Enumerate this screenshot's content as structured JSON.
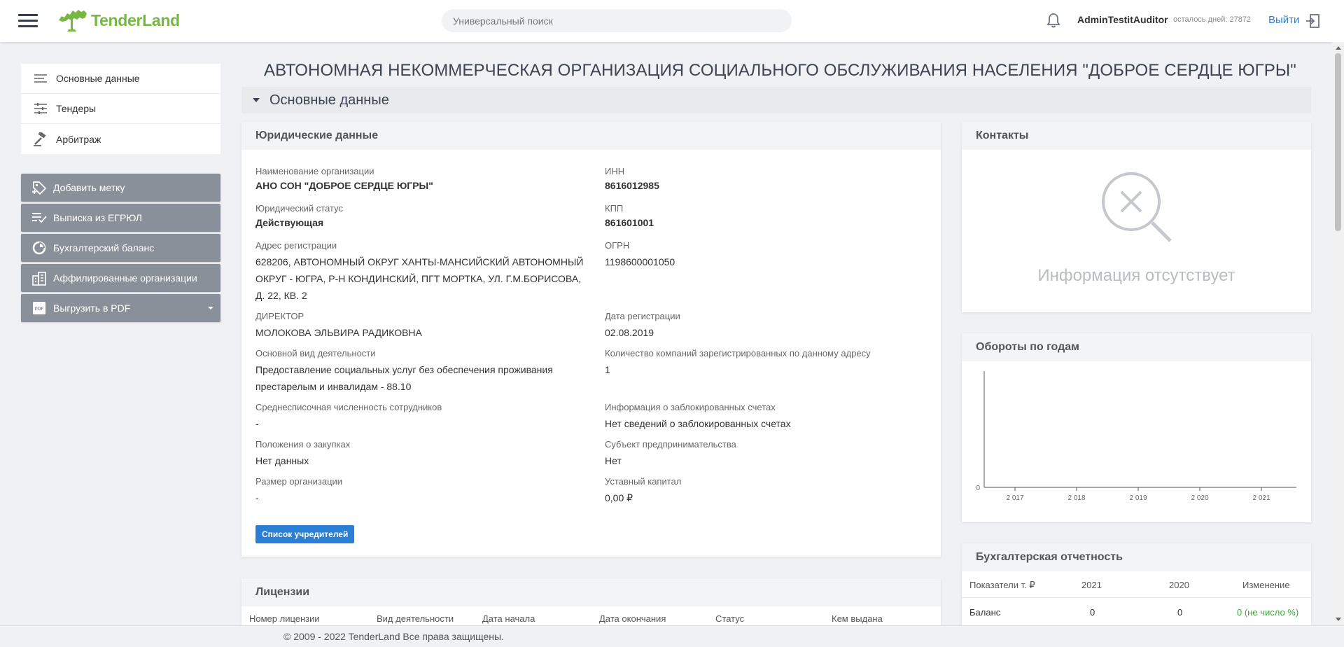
{
  "header": {
    "logo_text": "TenderLand",
    "search_placeholder": "Универсальный поиск",
    "username": "AdminTestitAuditor",
    "days_left": "осталось дней: 27872",
    "logout_label": "Выйти"
  },
  "sidebar": {
    "items": [
      {
        "label": "Основные данные",
        "icon": "lines-icon"
      },
      {
        "label": "Тендеры",
        "icon": "sliders-icon"
      },
      {
        "label": "Арбитраж",
        "icon": "gavel-icon"
      }
    ],
    "actions": [
      {
        "label": "Добавить метку",
        "icon": "tag-add-icon"
      },
      {
        "label": "Выписка из ЕГРЮЛ",
        "icon": "list-check-icon"
      },
      {
        "label": "Бухгалтерский баланс",
        "icon": "pie-chart-icon"
      },
      {
        "label": "Аффилированные организации",
        "icon": "buildings-icon"
      },
      {
        "label": "Выгрузить в PDF",
        "icon": "pdf-icon"
      }
    ]
  },
  "main": {
    "org_title": "АВТОНОМНАЯ НЕКОММЕРЧЕСКАЯ ОРГАНИЗАЦИЯ СОЦИАЛЬНОГО ОБСЛУЖИВАНИЯ НАСЕЛЕНИЯ \"ДОБРОЕ СЕРДЦЕ ЮГРЫ\"",
    "section_label": "Основные данные"
  },
  "legal": {
    "title": "Юридические данные",
    "fields": [
      {
        "label": "Наименование организации",
        "value": "АНО СОН \"ДОБРОЕ СЕРДЦЕ ЮГРЫ\""
      },
      {
        "label": "ИНН",
        "value": "8616012985"
      },
      {
        "label": "Юридический статус",
        "value": "Действующая"
      },
      {
        "label": "КПП",
        "value": "861601001"
      },
      {
        "label": "Адрес регистрации",
        "value": "628206, АВТОНОМНЫЙ ОКРУГ ХАНТЫ-МАНСИЙСКИЙ АВТОНОМНЫЙ ОКРУГ - ЮГРА, Р-Н КОНДИНСКИЙ, ПГТ МОРТКА, УЛ. Г.М.БОРИСОВА, Д. 22, КВ. 2"
      },
      {
        "label": "ОГРН",
        "value": "1198600001050"
      },
      {
        "label": "ДИРЕКТОР",
        "value": "МОЛОКОВА ЭЛЬВИРА РАДИКОВНА"
      },
      {
        "label": "Дата регистрации",
        "value": "02.08.2019"
      },
      {
        "label": "Основной вид деятельности",
        "value": "Предоставление социальных услуг без обеспечения проживания престарелым и инвалидам - 88.10"
      },
      {
        "label": "Количество компаний зарегистрированных по данному адресу",
        "value": "1"
      },
      {
        "label": "Среднесписочная численность сотрудников",
        "value": "-"
      },
      {
        "label": "Информация о заблокированных счетах",
        "value": "Нет сведений о заблокированных счетах"
      },
      {
        "label": "Положения о закупках",
        "value": "Нет данных"
      },
      {
        "label": "Субъект предпринимательства",
        "value": "Нет"
      },
      {
        "label": "Размер организации",
        "value": "-"
      },
      {
        "label": "Уставный капитал",
        "value": "0,00 ₽"
      }
    ],
    "founders_button": "Список учредителей"
  },
  "contacts": {
    "title": "Контакты",
    "empty_text": "Информация отсутствует"
  },
  "turnover": {
    "title": "Обороты по годам"
  },
  "chart_data": {
    "type": "bar",
    "categories": [
      "2 017",
      "2 018",
      "2 019",
      "2 020",
      "2 021"
    ],
    "values": [
      0,
      0,
      0,
      0,
      0
    ],
    "y_ticks": [
      "0"
    ],
    "grid": false
  },
  "licenses": {
    "title": "Лицензии",
    "columns": [
      "Номер лицензии",
      "Вид деятельности",
      "Дата начала",
      "Дата окончания",
      "Статус",
      "Кем выдана"
    ]
  },
  "accounting": {
    "title": "Бухгалтерская отчетность",
    "headers": [
      "Показатели т. ₽",
      "2021",
      "2020",
      "Изменение"
    ],
    "rows": [
      {
        "name": "Баланс",
        "y2021": "0",
        "y2020": "0",
        "change": "0 (не число %)"
      }
    ],
    "positive_color": "#3fa73c"
  },
  "footer": {
    "copyright": "© 2009 - 2022 TenderLand Все права защищены."
  }
}
